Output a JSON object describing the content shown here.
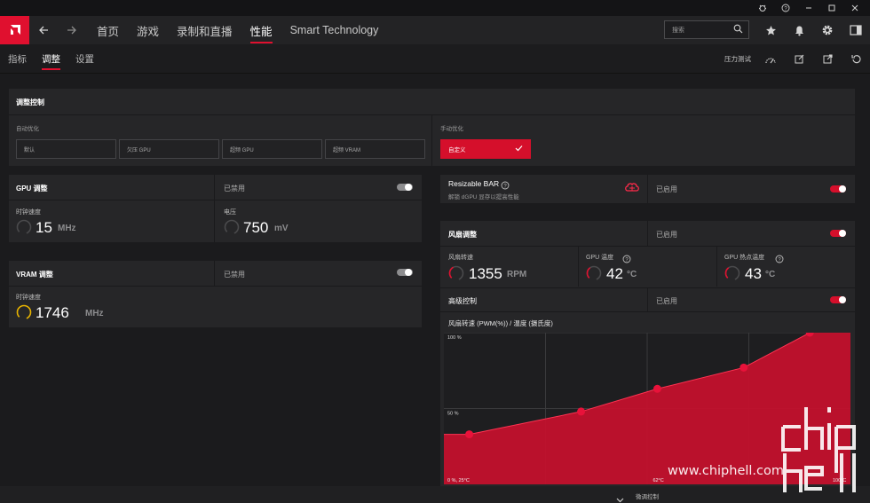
{
  "window": {
    "controls": [
      "bug-icon",
      "help-icon",
      "minimize-icon",
      "maximize-icon",
      "close-icon"
    ]
  },
  "nav": {
    "links": [
      "首页",
      "游戏",
      "录制和直播",
      "性能",
      "Smart Technology"
    ],
    "active": "性能",
    "search_placeholder": "搜索"
  },
  "subnav": {
    "tabs": [
      "指标",
      "调整",
      "设置"
    ],
    "active": "调整",
    "stress_test": "压力测试"
  },
  "tuning": {
    "title": "调整控制",
    "auto_label": "自动优化",
    "auto_options": [
      "默认",
      "欠压 GPU",
      "超频 GPU",
      "超频 VRAM"
    ],
    "manual_label": "手动优化",
    "manual_value": "自定义"
  },
  "gpu": {
    "title": "GPU 调整",
    "state": "已禁用",
    "enabled": false,
    "clock_label": "时钟速度",
    "clock_value": "15",
    "clock_unit": "MHz",
    "voltage_label": "电压",
    "voltage_value": "750",
    "voltage_unit": "mV"
  },
  "vram": {
    "title": "VRAM 调整",
    "state": "已禁用",
    "enabled": false,
    "clock_label": "时钟速度",
    "clock_value": "1746",
    "clock_unit": "MHz"
  },
  "rebar": {
    "title": "Resizable BAR",
    "desc": "解锁 dGPU 显存以提高性能",
    "state": "已启用",
    "enabled": true
  },
  "fan": {
    "title": "风扇调整",
    "state": "已启用",
    "enabled": true,
    "speed_label": "风扇转速",
    "speed_value": "1355",
    "speed_unit": "RPM",
    "temp_label": "GPU 温度",
    "temp_value": "42",
    "temp_unit": "°C",
    "hotspot_label": "GPU 热点温度",
    "hotspot_value": "43",
    "hotspot_unit": "°C",
    "advanced_label": "高级控制",
    "advanced_state": "已启用",
    "advanced_enabled": true
  },
  "chart_data": {
    "type": "area",
    "title": "风扇转速 (PWM(%)) / 温度 (摄氏度)",
    "y_ticks": [
      "100 %",
      "50 %"
    ],
    "x_ticks": [
      "0 %, 25°C",
      "62°C",
      "100°C"
    ],
    "points": [
      {
        "x": 25,
        "y": 33
      },
      {
        "x": 47,
        "y": 48
      },
      {
        "x": 62,
        "y": 63
      },
      {
        "x": 79,
        "y": 77
      },
      {
        "x": 92,
        "y": 100
      }
    ],
    "xlim": [
      20,
      100
    ],
    "ylim": [
      0,
      100
    ],
    "color": "#c8102e",
    "grid": true
  },
  "footer": {
    "label": "微调控制"
  },
  "watermark": {
    "brand": "chiphell",
    "url": "www.chiphell.com"
  }
}
